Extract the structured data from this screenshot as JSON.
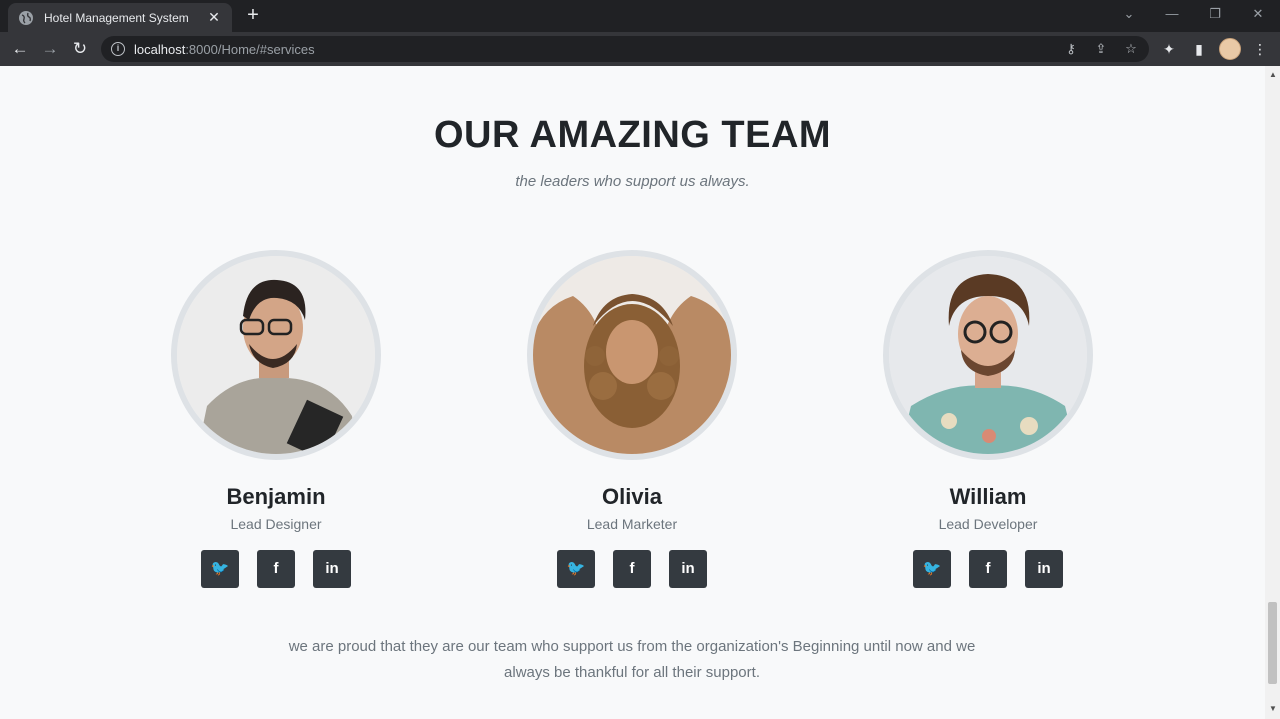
{
  "browser": {
    "tab_title": "Hotel Management System",
    "tab_close": "✕",
    "new_tab": "+",
    "url_host": "localhost",
    "url_path": ":8000/Home/#services"
  },
  "section": {
    "heading": "OUR AMAZING TEAM",
    "subheading": "the leaders who support us always."
  },
  "team": [
    {
      "name": "Benjamin",
      "role": "Lead Designer"
    },
    {
      "name": "Olivia",
      "role": "Lead Marketer"
    },
    {
      "name": "William",
      "role": "Lead Developer"
    }
  ],
  "social_labels": {
    "twitter": "🐦",
    "facebook": "f",
    "linkedin": "in"
  },
  "footer": {
    "text": "we are proud that they are our team who support us from the organization's Beginning until now and we always be thankful for all their support."
  },
  "colors": {
    "page_bg": "#f8f9fa",
    "heading": "#212529",
    "muted": "#6c757d",
    "social_bg": "#343a40",
    "avatar_ring": "#dee2e6"
  }
}
